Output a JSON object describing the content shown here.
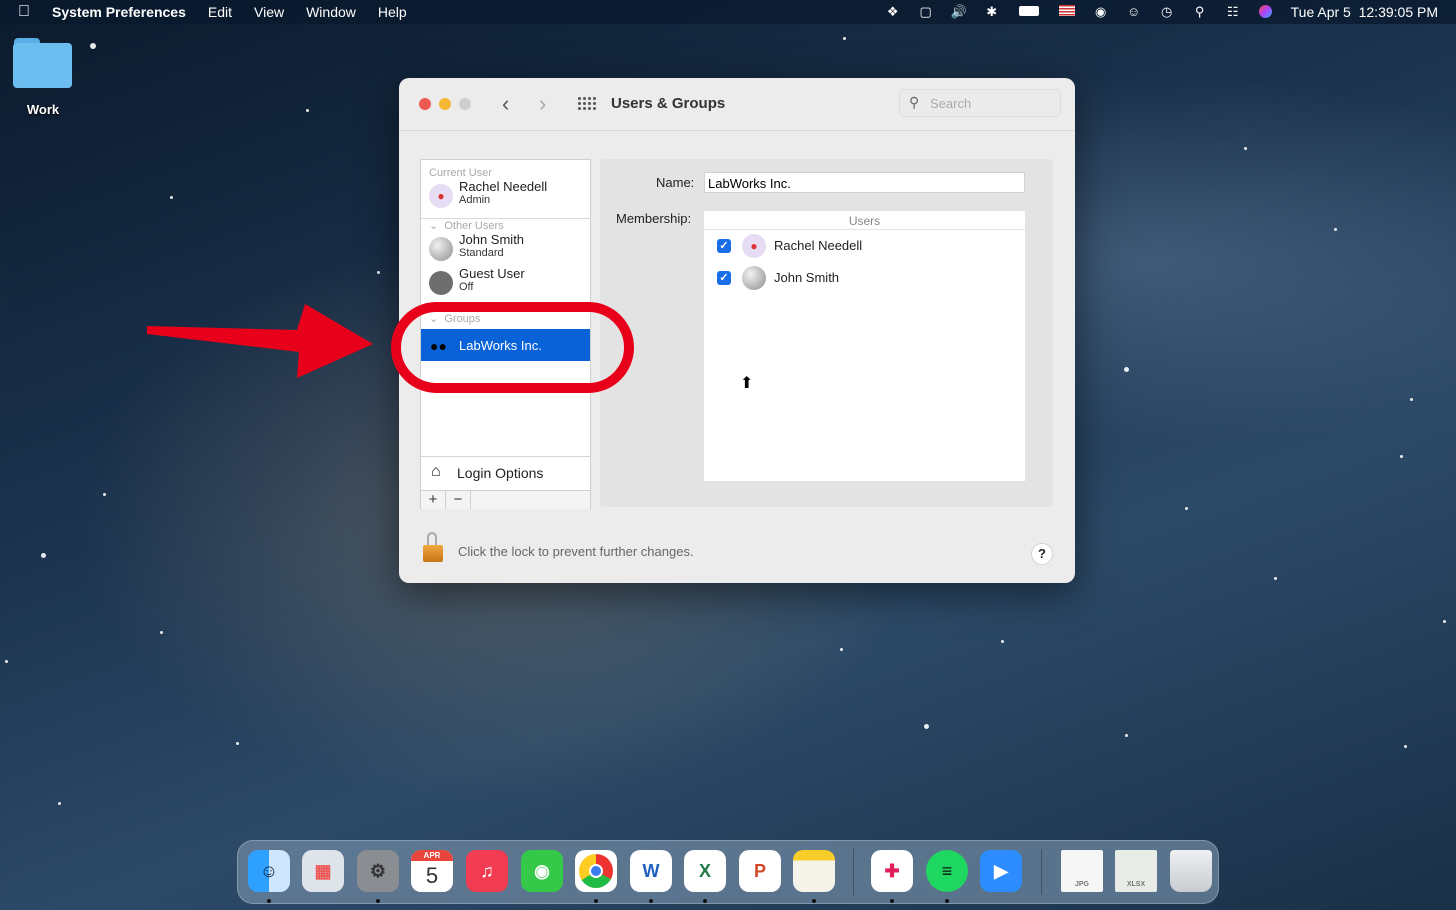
{
  "menubar": {
    "apple_icon": "apple-icon",
    "app_name": "System Preferences",
    "menus": [
      "Edit",
      "View",
      "Window",
      "Help"
    ],
    "status_icons": [
      "dropbox-icon",
      "badge-icon",
      "volume-icon",
      "bluetooth-icon",
      "battery-icon",
      "us-flag-icon",
      "wifi-icon",
      "user-account-icon",
      "time-machine-icon",
      "spotlight-search-icon",
      "control-center-icon",
      "siri-icon"
    ],
    "clock": "Tue Apr 5  12:39:05 PM"
  },
  "desktop": {
    "folder_label": "Work"
  },
  "window": {
    "title": "Users & Groups",
    "search_placeholder": "Search",
    "sidebar": {
      "current_user_header": "Current User",
      "current_user": {
        "name": "Rachel Needell",
        "role": "Admin"
      },
      "other_users_header": "Other Users",
      "other_users": [
        {
          "name": "John Smith",
          "role": "Standard"
        },
        {
          "name": "Guest User",
          "role": "Off"
        }
      ],
      "groups_header": "Groups",
      "groups": [
        {
          "name": "LabWorks Inc.",
          "selected": true
        }
      ],
      "login_options": "Login Options",
      "add_label": "+",
      "remove_label": "−"
    },
    "detail": {
      "name_label": "Name:",
      "name_value": "LabWorks Inc.",
      "membership_label": "Membership:",
      "users_column": "Users",
      "members": [
        {
          "name": "Rachel Needell",
          "checked": true
        },
        {
          "name": "John Smith",
          "checked": true
        }
      ]
    },
    "lock_text": "Click the lock to prevent further changes.",
    "help_label": "?"
  },
  "dock": {
    "apps": [
      {
        "name": "Finder",
        "running": true
      },
      {
        "name": "Launchpad",
        "running": false
      },
      {
        "name": "System Preferences",
        "running": true
      },
      {
        "name": "Calendar",
        "running": false,
        "month": "APR",
        "day": "5"
      },
      {
        "name": "Music",
        "running": false
      },
      {
        "name": "Messages",
        "running": false
      },
      {
        "name": "Google Chrome",
        "running": true
      },
      {
        "name": "Microsoft Word",
        "running": true,
        "glyph": "W"
      },
      {
        "name": "Microsoft Excel",
        "running": true,
        "glyph": "X"
      },
      {
        "name": "Microsoft PowerPoint",
        "running": false,
        "glyph": "P"
      },
      {
        "name": "Notes",
        "running": true
      },
      {
        "name": "Slack",
        "running": true
      },
      {
        "name": "Spotify",
        "running": true
      },
      {
        "name": "Zoom",
        "running": false
      },
      {
        "name": "JPG document",
        "running": false,
        "label": "JPG"
      },
      {
        "name": "XLSX document",
        "running": false,
        "label": "XLSX"
      },
      {
        "name": "Trash",
        "running": false
      }
    ]
  },
  "colors": {
    "selection": "#0a62d8",
    "annotation_red": "#e8001a",
    "checkbox": "#1a6ee8"
  }
}
